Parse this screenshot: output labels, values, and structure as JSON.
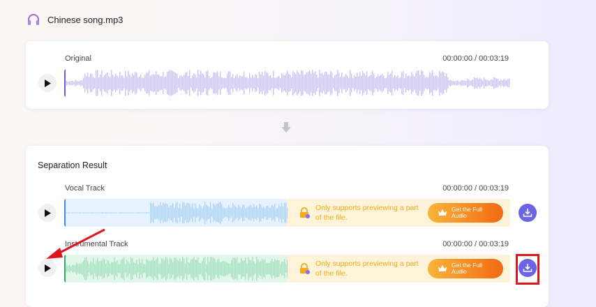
{
  "file": {
    "name": "Chinese song.mp3",
    "icon": "headphones-icon",
    "icon_color": "#a06ad7"
  },
  "original": {
    "label": "Original",
    "time": "00:00:00 / 00:03:19",
    "wave_color": "#cbc3f8",
    "cursor_color": "#6d5fe0"
  },
  "divider_icon": "arrow-down-icon",
  "result": {
    "title": "Separation Result",
    "tracks": [
      {
        "label": "Vocal Track",
        "time": "00:00:00 / 00:03:19",
        "wave_bg": "#e6f2fd",
        "wave_color": "#aed4f7",
        "cursor_color": "#3b8fe0",
        "notice_line1": "Only supports previewing a part",
        "notice_line2": "of the file.",
        "cta_line1": "Get the Full",
        "cta_line2": "Audio"
      },
      {
        "label": "Instrumental Track",
        "time": "00:00:00 / 00:03:19",
        "wave_bg": "#e2f7ea",
        "wave_color": "#a5e1bf",
        "cursor_color": "#32a76a",
        "notice_line1": "Only supports previewing a part",
        "notice_line2": "of the file.",
        "cta_line1": "Get the Full",
        "cta_line2": "Audio"
      }
    ]
  },
  "colors": {
    "accent": "#6d63e6",
    "notice_text": "#f3a91a",
    "cta_start": "#fbb43a",
    "cta_end": "#f26a12",
    "annotation_red": "#e0141b"
  }
}
